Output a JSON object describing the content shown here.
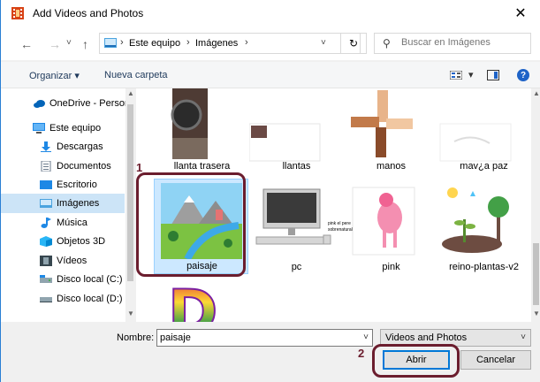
{
  "window": {
    "title": "Add Videos and Photos",
    "close_glyph": "✕"
  },
  "nav": {
    "back_glyph": "←",
    "forward_glyph": "→",
    "recent_glyph": "˅",
    "up_glyph": "↑",
    "breadcrumbs": [
      "Este equipo",
      "Imágenes"
    ],
    "sep_glyph": "›",
    "dropdown_glyph": "˅",
    "refresh_glyph": "↻",
    "search_placeholder": "Buscar en Imágenes",
    "search_glyph": "⚲"
  },
  "commands": {
    "organize": "Organizar ▾",
    "new_folder": "Nueva carpeta",
    "view_dd": "▾",
    "help": "?"
  },
  "sidebar": {
    "items": [
      {
        "label": "OneDrive - Persor",
        "icon": "cloud-icon",
        "color": "#0364b8"
      },
      {
        "label": "Este equipo",
        "icon": "computer-icon",
        "color": "#1e88e5"
      },
      {
        "label": "Descargas",
        "icon": "download-icon",
        "color": "#1e88e5"
      },
      {
        "label": "Documentos",
        "icon": "document-icon",
        "color": "#9aa7b5"
      },
      {
        "label": "Escritorio",
        "icon": "desktop-icon",
        "color": "#1e88e5"
      },
      {
        "label": "Imágenes",
        "icon": "pictures-icon",
        "color": "#4aa3df"
      },
      {
        "label": "Música",
        "icon": "music-icon",
        "color": "#1e88e5"
      },
      {
        "label": "Objetos 3D",
        "icon": "cube-icon",
        "color": "#29b6f6"
      },
      {
        "label": "Vídeos",
        "icon": "film-icon",
        "color": "#37474f"
      },
      {
        "label": "Disco local (C:)",
        "icon": "drive-icon",
        "color": "#607d8b"
      },
      {
        "label": "Disco local (D:)",
        "icon": "drive-icon",
        "color": "#607d8b"
      }
    ],
    "selected_index": 5
  },
  "files": [
    {
      "caption": "llanta trasera",
      "kind": "llanta"
    },
    {
      "caption": "llantas",
      "kind": "llantas"
    },
    {
      "caption": "manos",
      "kind": "manos"
    },
    {
      "caption": "mav¿a     paz",
      "kind": "mav"
    },
    {
      "caption": "paisaje",
      "kind": "paisaje",
      "selected": true
    },
    {
      "caption": "pc",
      "kind": "pc"
    },
    {
      "caption": "pink",
      "kind": "pink",
      "thumb_text": "pink el pere sobrenatural"
    },
    {
      "caption": "reino-plantas-v2",
      "kind": "plantas"
    },
    {
      "caption": "",
      "kind": "letter",
      "thumb_letter": "D"
    }
  ],
  "footer": {
    "filename_label": "Nombre:",
    "filename_value": "paisaje",
    "filter_value": "Videos and Photos",
    "open_label": "Abrir",
    "cancel_label": "Cancelar",
    "dd_glyph": "˅"
  },
  "annotations": {
    "step1": "1",
    "step2": "2",
    "highlight_color": "#6b1d2e"
  }
}
